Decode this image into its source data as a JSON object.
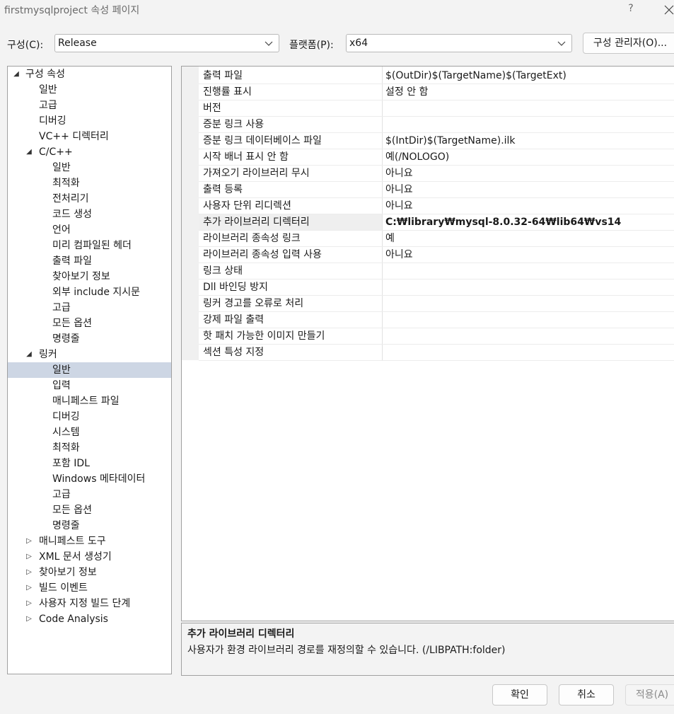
{
  "window": {
    "title": "firstmysqlproject 속성 페이지",
    "help_label": "?"
  },
  "config": {
    "label": "구성(C):",
    "value": "Release",
    "platform_label": "플랫폼(P):",
    "platform_value": "x64",
    "manager_button": "구성 관리자(O)..."
  },
  "tree": {
    "items": [
      {
        "label": "구성 속성",
        "level": 0,
        "arrow": "expanded"
      },
      {
        "label": "일반",
        "level": 1,
        "arrow": ""
      },
      {
        "label": "고급",
        "level": 1,
        "arrow": ""
      },
      {
        "label": "디버깅",
        "level": 1,
        "arrow": ""
      },
      {
        "label": "VC++ 디렉터리",
        "level": 1,
        "arrow": ""
      },
      {
        "label": "C/C++",
        "level": 1,
        "arrow": "expanded"
      },
      {
        "label": "일반",
        "level": 2,
        "arrow": ""
      },
      {
        "label": "최적화",
        "level": 2,
        "arrow": ""
      },
      {
        "label": "전처리기",
        "level": 2,
        "arrow": ""
      },
      {
        "label": "코드 생성",
        "level": 2,
        "arrow": ""
      },
      {
        "label": "언어",
        "level": 2,
        "arrow": ""
      },
      {
        "label": "미리 컴파일된 헤더",
        "level": 2,
        "arrow": ""
      },
      {
        "label": "출력 파일",
        "level": 2,
        "arrow": ""
      },
      {
        "label": "찾아보기 정보",
        "level": 2,
        "arrow": ""
      },
      {
        "label": "외부 include 지시문",
        "level": 2,
        "arrow": ""
      },
      {
        "label": "고급",
        "level": 2,
        "arrow": ""
      },
      {
        "label": "모든 옵션",
        "level": 2,
        "arrow": ""
      },
      {
        "label": "명령줄",
        "level": 2,
        "arrow": ""
      },
      {
        "label": "링커",
        "level": 1,
        "arrow": "expanded"
      },
      {
        "label": "일반",
        "level": 2,
        "arrow": "",
        "selected": true
      },
      {
        "label": "입력",
        "level": 2,
        "arrow": ""
      },
      {
        "label": "매니페스트 파일",
        "level": 2,
        "arrow": ""
      },
      {
        "label": "디버깅",
        "level": 2,
        "arrow": ""
      },
      {
        "label": "시스템",
        "level": 2,
        "arrow": ""
      },
      {
        "label": "최적화",
        "level": 2,
        "arrow": ""
      },
      {
        "label": "포함 IDL",
        "level": 2,
        "arrow": ""
      },
      {
        "label": "Windows 메타데이터",
        "level": 2,
        "arrow": ""
      },
      {
        "label": "고급",
        "level": 2,
        "arrow": ""
      },
      {
        "label": "모든 옵션",
        "level": 2,
        "arrow": ""
      },
      {
        "label": "명령줄",
        "level": 2,
        "arrow": ""
      },
      {
        "label": "매니페스트 도구",
        "level": 1,
        "arrow": "collapsed"
      },
      {
        "label": "XML 문서 생성기",
        "level": 1,
        "arrow": "collapsed"
      },
      {
        "label": "찾아보기 정보",
        "level": 1,
        "arrow": "collapsed"
      },
      {
        "label": "빌드 이벤트",
        "level": 1,
        "arrow": "collapsed"
      },
      {
        "label": "사용자 지정 빌드 단계",
        "level": 1,
        "arrow": "collapsed"
      },
      {
        "label": "Code Analysis",
        "level": 1,
        "arrow": "collapsed"
      }
    ]
  },
  "properties": [
    {
      "name": "출력 파일",
      "value": "$(OutDir)$(TargetName)$(TargetExt)"
    },
    {
      "name": "진행률 표시",
      "value": "설정 안 함"
    },
    {
      "name": "버전",
      "value": ""
    },
    {
      "name": "증분 링크 사용",
      "value": ""
    },
    {
      "name": "증분 링크 데이터베이스 파일",
      "value": "$(IntDir)$(TargetName).ilk"
    },
    {
      "name": "시작 배너 표시 안 함",
      "value": "예(/NOLOGO)"
    },
    {
      "name": "가져오기 라이브러리 무시",
      "value": "아니요"
    },
    {
      "name": "출력 등록",
      "value": "아니요"
    },
    {
      "name": "사용자 단위 리디렉션",
      "value": "아니요"
    },
    {
      "name": "추가 라이브러리 디렉터리",
      "value": "C:₩library₩mysql-8.0.32-64₩lib64₩vs14",
      "selected": true
    },
    {
      "name": "라이브러리 종속성 링크",
      "value": "예"
    },
    {
      "name": "라이브러리 종속성 입력 사용",
      "value": "아니요"
    },
    {
      "name": "링크 상태",
      "value": ""
    },
    {
      "name": "Dll 바인딩 방지",
      "value": ""
    },
    {
      "name": "링커 경고를 오류로 처리",
      "value": ""
    },
    {
      "name": "강제 파일 출력",
      "value": ""
    },
    {
      "name": "핫 패치 가능한 이미지 만들기",
      "value": ""
    },
    {
      "name": "섹션 특성 지정",
      "value": ""
    }
  ],
  "description": {
    "title": "추가 라이브러리 디렉터리",
    "text": "사용자가 환경 라이브러리 경로를 재정의할 수 있습니다. (/LIBPATH:folder)"
  },
  "buttons": {
    "ok": "확인",
    "cancel": "취소",
    "apply": "적용(A)"
  },
  "colors": {
    "selection": "#cdd6e4",
    "dialog_bg": "#f3f3f3"
  }
}
